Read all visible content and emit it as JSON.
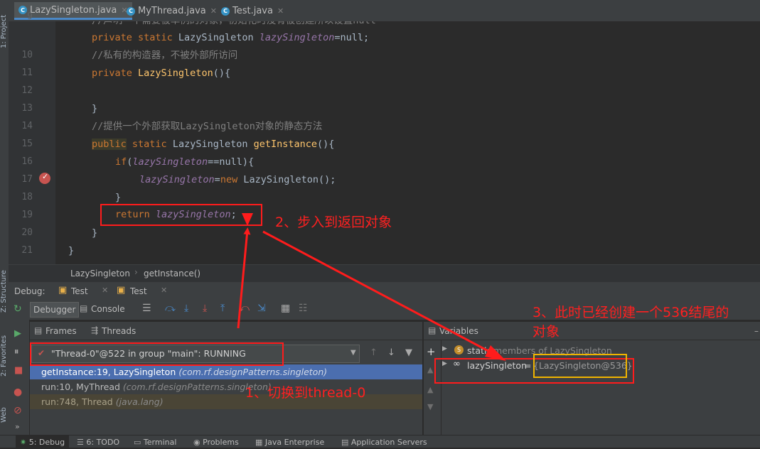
{
  "left_strip": {
    "project": "1: Project",
    "structure": "Z: Structure",
    "favorites": "2: Favorites",
    "web": "Web"
  },
  "tabs": [
    {
      "label": "LazySingleton.java",
      "active": true
    },
    {
      "label": "MyThread.java",
      "active": false
    },
    {
      "label": "Test.java",
      "active": false
    }
  ],
  "editor": {
    "line_numbers": [
      "9",
      "10",
      "11",
      "12",
      "13",
      "14",
      "15",
      "16",
      "17",
      "18",
      "19",
      "20",
      "21"
    ],
    "line8_partial": "//声明一个需要被单例的对象，初始化时没有被创建所以设置null",
    "line9": {
      "kw": "private static",
      "type": " LazySingleton ",
      "field": "lazySingleton",
      "rest": "=null;"
    },
    "line10": "//私有的构造器，不被外部所访问",
    "line11": {
      "kw": "private",
      "fn": " LazySingleton",
      "rest": "(){"
    },
    "line13": "}",
    "line14": "//提供一个外部获取LazySingleton对象的静态方法",
    "line15": {
      "kw1": "public",
      "kw2": " static",
      "type": " LazySingleton ",
      "fn": "getInstance",
      "rest": "(){"
    },
    "line16": {
      "kw": "if",
      "p": "(",
      "field": "lazySingleton",
      "rest": "==null){"
    },
    "line17": {
      "field": "lazySingleton",
      "eq": "=",
      "kw": "new",
      "rest": " LazySingleton();"
    },
    "line18": "}",
    "line19": {
      "kw": "return",
      "field": " lazySingleton",
      "rest": ";"
    },
    "line20": "}",
    "line21": "}"
  },
  "breadcrumb": {
    "class": "LazySingleton",
    "method": "getInstance()"
  },
  "debug": {
    "label": "Debug:",
    "tab1": "Test",
    "tab2": "Test"
  },
  "toolbar": {
    "debugger": "Debugger",
    "console": "Console"
  },
  "frames_panel": {
    "frames_tab": "Frames",
    "threads_tab": "Threads",
    "thread_select": "\"Thread-0\"@522 in group \"main\": RUNNING"
  },
  "frames": [
    {
      "method": "getInstance:19, LazySingleton",
      "pkg": "(com.rf.designPatterns.singleton)"
    },
    {
      "method": "run:10, MyThread",
      "pkg": "(com.rf.designPatterns.singleton)"
    },
    {
      "method": "run:748, Thread",
      "pkg": "(java.lang)"
    }
  ],
  "variables": {
    "header": "Variables",
    "static_label": "static",
    "static_rest": "members of LazySingleton",
    "var_name": "lazySingleton",
    "var_eq": " = ",
    "var_value": "{LazySingleton@536}"
  },
  "annotations": {
    "a1": "1、切换到thread-0",
    "a2": "2、步入到返回对象",
    "a3_line1": "3、此时已经创建一个536结尾的",
    "a3_line2": "对象"
  },
  "bottom_tabs": [
    "5: Debug",
    "6: TODO",
    "Terminal",
    "Problems",
    "Java Enterprise",
    "Application Servers"
  ],
  "colors": {
    "accent": "#2f65ca",
    "annotation": "#ff1c1c",
    "highlight_box": "#f0b400"
  }
}
